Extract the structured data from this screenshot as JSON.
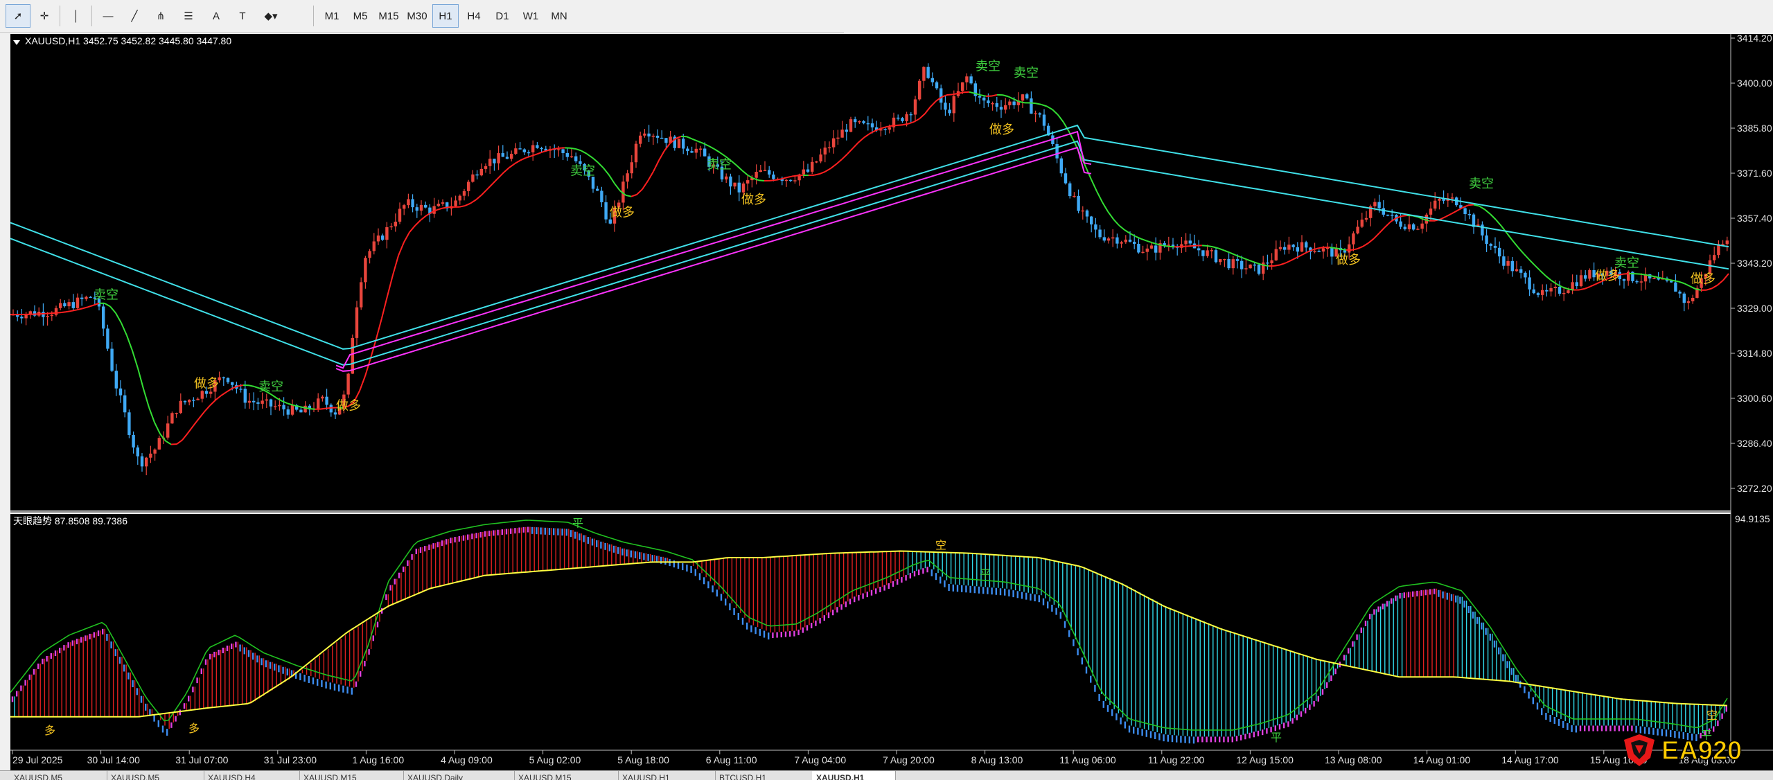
{
  "toolbar": {
    "tools": [
      {
        "name": "cursor-icon",
        "glyph": "➚"
      },
      {
        "name": "crosshair-icon",
        "glyph": "✛"
      },
      {
        "name": "vertical-line-icon",
        "glyph": "│"
      },
      {
        "name": "horizontal-line-icon",
        "glyph": "—"
      },
      {
        "name": "trendline-icon",
        "glyph": "╱"
      },
      {
        "name": "pitchfork-icon",
        "glyph": "⋔"
      },
      {
        "name": "fibonacci-icon",
        "glyph": "☰"
      },
      {
        "name": "text-icon",
        "glyph": "A"
      },
      {
        "name": "text-label-icon",
        "glyph": "T"
      },
      {
        "name": "shapes-dropdown-icon",
        "glyph": "◆▾"
      }
    ],
    "timeframes": [
      "M1",
      "M5",
      "M15",
      "M30",
      "H1",
      "H4",
      "D1",
      "W1",
      "MN"
    ],
    "active_timeframe": "H1"
  },
  "main_chart": {
    "header": "XAUUSD,H1  3452.75 3452.82 3445.80 3447.80",
    "price_labels": [
      "3414.20",
      "3400.00",
      "3385.80",
      "3371.60",
      "3357.40",
      "3343.20",
      "3329.00",
      "3314.80",
      "3300.60",
      "3286.40",
      "3272.20"
    ],
    "signals": [
      {
        "text": "卖空",
        "type": "sell"
      },
      {
        "text": "做多",
        "type": "buy"
      }
    ]
  },
  "sub_chart": {
    "header": "天眼趋势 87.8508 89.7386",
    "top_label": "94.9135",
    "signal_labels": {
      "flat": "平",
      "long": "多",
      "short": "空"
    }
  },
  "x_axis_labels": [
    "29 Jul 2025",
    "30 Jul 14:00",
    "31 Jul 07:00",
    "31 Jul 23:00",
    "1 Aug 16:00",
    "4 Aug 09:00",
    "5 Aug 02:00",
    "5 Aug 18:00",
    "6 Aug 11:00",
    "7 Aug 04:00",
    "7 Aug 20:00",
    "8 Aug 13:00",
    "11 Aug 06:00",
    "11 Aug 22:00",
    "12 Aug 15:00",
    "13 Aug 08:00",
    "14 Aug 01:00",
    "14 Aug 17:00",
    "15 Aug 10:00",
    "18 Aug 03:00"
  ],
  "tabs": [
    "XAUUSD,M5",
    "XAUUSD,M5",
    "XAUUSD,H4",
    "XAUUSD,M15",
    "XAUUSD,Daily",
    "XAUUSD,M15",
    "XAUUSD,H1",
    "BTCUSD,H1",
    "XAUUSD,H1"
  ],
  "active_tab_index": 8,
  "logo_text": "EA920",
  "colors": {
    "bull": "#e8453c",
    "bear": "#3fa9f5",
    "ema_fast_up": "#ff2020",
    "ema_fast_down": "#33dd33",
    "ema_cyan": "#40e0e8",
    "ema_magenta": "#ff33ff",
    "signal_text": "#f0c020",
    "sell_text": "#40d040",
    "osc_up": "#e040e0",
    "osc_down": "#3c8cf0",
    "osc_line": "#20c020",
    "slow_up": "#e02020",
    "slow_down": "#30d8e8",
    "slow_line": "#ffff40"
  }
}
